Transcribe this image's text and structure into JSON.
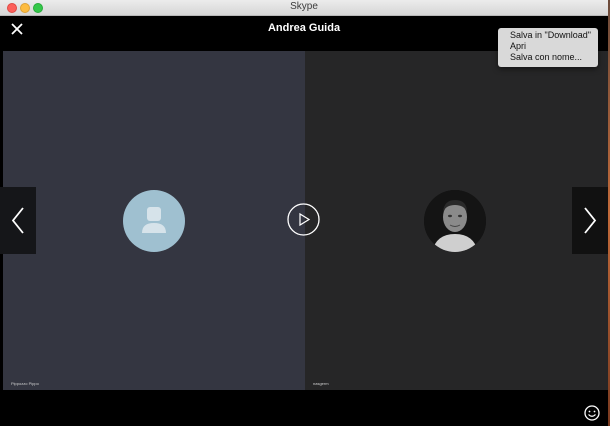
{
  "window": {
    "app_title": "Skype"
  },
  "header": {
    "contact_name": "Andrea Guida",
    "more_label": "•••"
  },
  "panels": {
    "left": {
      "caption": "Pippozzo Pippo"
    },
    "right": {
      "caption": "nasgerm"
    }
  },
  "context_menu": {
    "items": [
      {
        "label": "Salva in \"Download\""
      },
      {
        "label": "Apri"
      },
      {
        "label": "Salva con nome..."
      }
    ]
  },
  "colors": {
    "left_panel": "#343641",
    "right_panel": "#262627",
    "avatar_generic": "#9fc0d0",
    "menu_bg": "#d9d9d9"
  },
  "icons": {
    "close": "close-icon",
    "play": "play-icon",
    "nav_left": "chevron-left-icon",
    "nav_right": "chevron-right-icon",
    "emoji": "emoji-icon",
    "avatar_placeholder": "user-silhouette-icon"
  }
}
